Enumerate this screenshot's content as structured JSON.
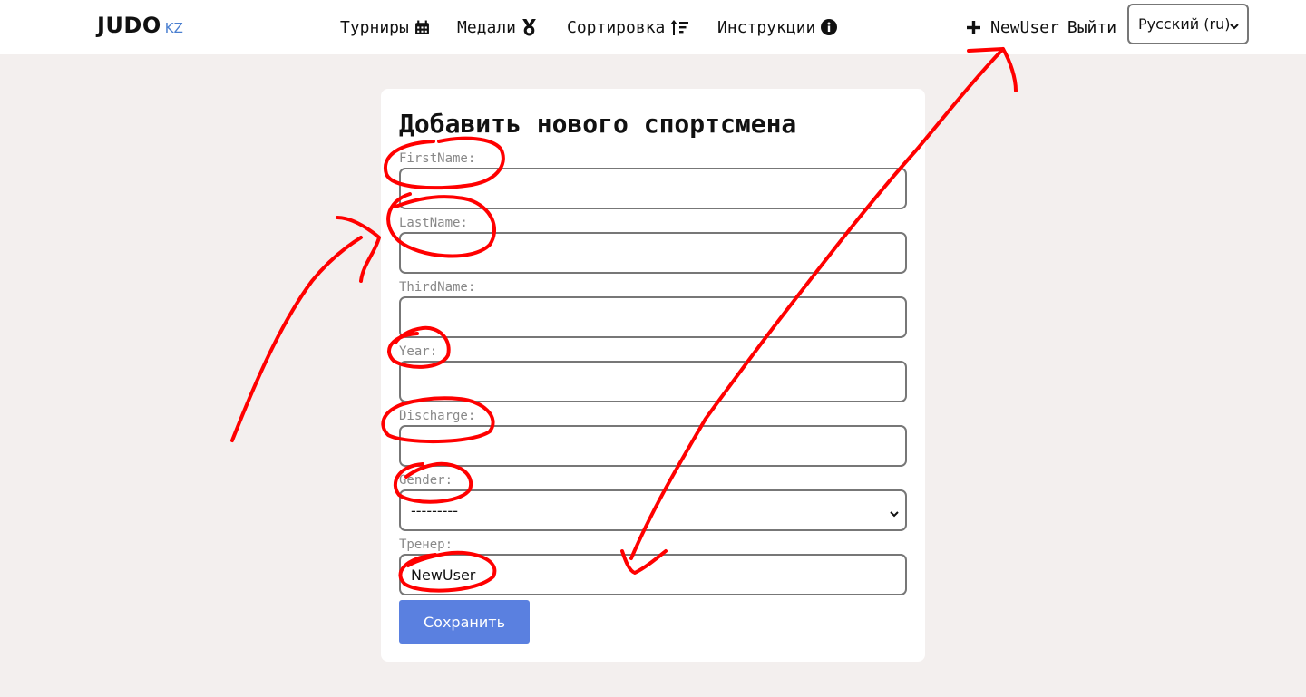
{
  "header": {
    "logo_main": "JUDO",
    "logo_sub": "KZ",
    "nav": [
      {
        "label": "Турниры",
        "icon": "calendar-icon"
      },
      {
        "label": "Медали",
        "icon": "medal-icon"
      },
      {
        "label": "Сортировка",
        "icon": "sort-icon"
      },
      {
        "label": "Инструкции",
        "icon": "info-icon"
      }
    ],
    "user": {
      "add_icon": "plus-icon",
      "username": "NewUser",
      "logout_label": "Выйти"
    },
    "language": {
      "selected": "Русский (ru)"
    }
  },
  "form": {
    "title": "Добавить нового спортсмена",
    "fields": [
      {
        "label": "FirstName:",
        "value": ""
      },
      {
        "label": "LastName:",
        "value": ""
      },
      {
        "label": "ThirdName:",
        "value": ""
      },
      {
        "label": "Year:",
        "value": ""
      },
      {
        "label": "Discharge:",
        "value": ""
      },
      {
        "label": "Gender:",
        "value": "---------"
      },
      {
        "label": "Тренер:",
        "value": "NewUser"
      }
    ],
    "save_label": "Сохранить"
  },
  "colors": {
    "accent_button": "#5a80e0",
    "logo_sub": "#4a7fd0",
    "page_background": "#f3efee",
    "annotation": "#ff0000"
  }
}
